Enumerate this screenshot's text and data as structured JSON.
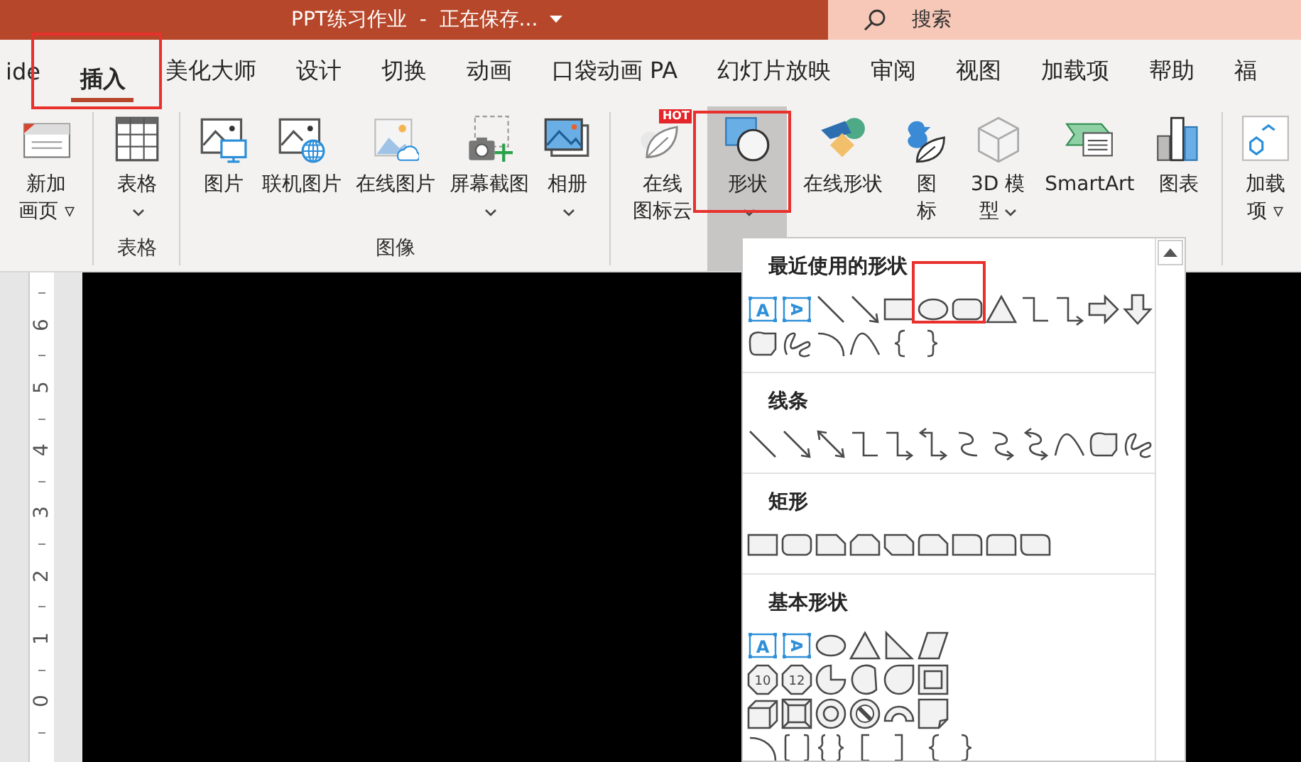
{
  "window": {
    "title": "PPT练习作业  -  正在保存...",
    "search": {
      "placeholder": "搜索"
    }
  },
  "tabs": [
    {
      "label": "ide",
      "selected": false,
      "highlighted": false
    },
    {
      "label": "插入",
      "selected": true,
      "highlighted": true
    },
    {
      "label": "美化大师",
      "selected": false,
      "highlighted": false
    },
    {
      "label": "设计",
      "selected": false,
      "highlighted": false
    },
    {
      "label": "切换",
      "selected": false,
      "highlighted": false
    },
    {
      "label": "动画",
      "selected": false,
      "highlighted": false
    },
    {
      "label": "口袋动画 PA",
      "selected": false,
      "highlighted": false
    },
    {
      "label": "幻灯片放映",
      "selected": false,
      "highlighted": false
    },
    {
      "label": "审阅",
      "selected": false,
      "highlighted": false
    },
    {
      "label": "视图",
      "selected": false,
      "highlighted": false
    },
    {
      "label": "加载项",
      "selected": false,
      "highlighted": false
    },
    {
      "label": "帮助",
      "selected": false,
      "highlighted": false
    },
    {
      "label": "福",
      "selected": false,
      "highlighted": false
    }
  ],
  "ribbon": {
    "groups": [
      {
        "buttons": [
          {
            "kind": "newslide",
            "lines": [
              "新加",
              "画页 ▿"
            ],
            "caret": false,
            "selected": false,
            "highlighted": false
          }
        ]
      },
      {
        "label": "表格",
        "buttons": [
          {
            "kind": "table",
            "lines": [
              "表格"
            ],
            "caret": true,
            "selected": false,
            "highlighted": false
          }
        ]
      },
      {
        "label": "图像",
        "buttons": [
          {
            "kind": "picture",
            "lines": [
              "图片"
            ],
            "caret": false,
            "selected": false,
            "highlighted": false
          },
          {
            "kind": "onlinepicture",
            "lines": [
              "联机图片"
            ],
            "caret": false,
            "selected": false,
            "highlighted": false
          },
          {
            "kind": "stockpicture",
            "lines": [
              "在线图片"
            ],
            "caret": false,
            "selected": false,
            "highlighted": false
          },
          {
            "kind": "screenshot",
            "lines": [
              "屏幕截图"
            ],
            "caret": true,
            "selected": false,
            "highlighted": false
          },
          {
            "kind": "album",
            "lines": [
              "相册"
            ],
            "caret": true,
            "selected": false,
            "highlighted": false
          }
        ]
      },
      {
        "buttons": [
          {
            "kind": "iconcloud",
            "lines": [
              "在线",
              "图标云"
            ],
            "badge": "HOT",
            "caret": false,
            "selected": false,
            "highlighted": false
          },
          {
            "kind": "shapes",
            "lines": [
              "形状"
            ],
            "caret": true,
            "selected": true,
            "highlighted": true
          },
          {
            "kind": "onlineshapes",
            "lines": [
              "在线形状"
            ],
            "caret": false,
            "selected": false,
            "highlighted": false
          },
          {
            "kind": "icons",
            "lines": [
              "图",
              "标"
            ],
            "caret": false,
            "selected": false,
            "highlighted": false
          },
          {
            "kind": "model",
            "lines": [
              "3D 模",
              "型"
            ],
            "caret": true,
            "selected": false,
            "highlighted": false
          },
          {
            "kind": "smartart",
            "lines": [
              "SmartArt"
            ],
            "caret": false,
            "selected": false,
            "highlighted": false
          },
          {
            "kind": "chart",
            "lines": [
              "图表"
            ],
            "caret": false,
            "selected": false,
            "highlighted": false
          }
        ]
      },
      {
        "buttons": [
          {
            "kind": "addin",
            "lines": [
              "加载",
              "项 ▿"
            ],
            "caret": false,
            "selected": false,
            "highlighted": false
          }
        ]
      }
    ]
  },
  "ruler": {
    "marks": [
      "6",
      "5",
      "4",
      "3",
      "2",
      "1",
      "0"
    ]
  },
  "shape_gallery": {
    "sections": [
      {
        "title": "最近使用的形状",
        "rows": [
          [
            {
              "kind": "textbox",
              "label": "A"
            },
            {
              "kind": "vtextbox",
              "label": "A"
            },
            {
              "kind": "line"
            },
            {
              "kind": "arrow"
            },
            {
              "kind": "rect"
            },
            {
              "kind": "oval",
              "highlighted": true
            },
            {
              "kind": "roundrect"
            },
            {
              "kind": "triangle"
            },
            {
              "kind": "elbow"
            },
            {
              "kind": "elbowarrow"
            },
            {
              "kind": "rightarrow"
            },
            {
              "kind": "downarrow"
            }
          ],
          [
            {
              "kind": "freeform"
            },
            {
              "kind": "scribble"
            },
            {
              "kind": "arc"
            },
            {
              "kind": "curve"
            },
            {
              "kind": "leftbrace"
            },
            {
              "kind": "rightbrace"
            }
          ]
        ]
      },
      {
        "title": "线条",
        "rows": [
          [
            {
              "kind": "line"
            },
            {
              "kind": "arrow"
            },
            {
              "kind": "doublearrow"
            },
            {
              "kind": "elbow"
            },
            {
              "kind": "elbowarrow"
            },
            {
              "kind": "elbowdouble"
            },
            {
              "kind": "curvedconn"
            },
            {
              "kind": "curvedarrow"
            },
            {
              "kind": "curveddouble"
            },
            {
              "kind": "curve"
            },
            {
              "kind": "freeform"
            },
            {
              "kind": "scribble"
            }
          ]
        ]
      },
      {
        "title": "矩形",
        "rows": [
          [
            {
              "kind": "rect"
            },
            {
              "kind": "roundrect"
            },
            {
              "kind": "snip1"
            },
            {
              "kind": "snip2"
            },
            {
              "kind": "snipdiag"
            },
            {
              "kind": "sniproundrect"
            },
            {
              "kind": "round1"
            },
            {
              "kind": "round2"
            },
            {
              "kind": "rounddiag"
            }
          ]
        ]
      },
      {
        "title": "基本形状",
        "rows": [
          [
            {
              "kind": "textbox",
              "label": "A"
            },
            {
              "kind": "vtextbox",
              "label": "A"
            },
            {
              "kind": "oval"
            },
            {
              "kind": "triangle"
            },
            {
              "kind": "righttriangle"
            },
            {
              "kind": "parallelogram"
            }
          ],
          [
            {
              "kind": "octagon",
              "label": "10"
            },
            {
              "kind": "octagon",
              "label": "12"
            },
            {
              "kind": "pie"
            },
            {
              "kind": "chord"
            },
            {
              "kind": "teardrop"
            },
            {
              "kind": "frame"
            }
          ],
          [
            {
              "kind": "cube"
            },
            {
              "kind": "bevel"
            },
            {
              "kind": "donut"
            },
            {
              "kind": "nosymbol"
            },
            {
              "kind": "blockarc"
            },
            {
              "kind": "folded"
            }
          ],
          [
            {
              "kind": "arc"
            },
            {
              "kind": "bracketpair"
            },
            {
              "kind": "bracepair"
            },
            {
              "kind": "leftbracket"
            },
            {
              "kind": "rightbracket"
            },
            {
              "kind": "leftbrace"
            },
            {
              "kind": "rightbrace"
            }
          ]
        ]
      }
    ]
  }
}
